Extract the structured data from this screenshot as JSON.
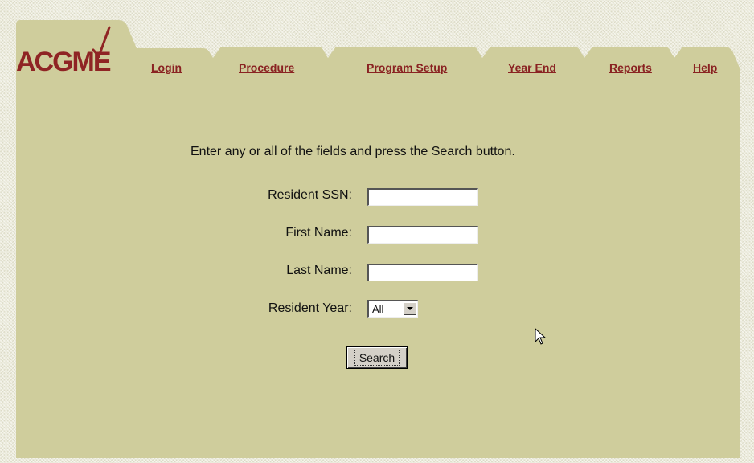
{
  "brand": {
    "logo_text": "ACGME",
    "accent": "#8a2222",
    "panel_color": "#cfcd9c"
  },
  "nav": {
    "items": [
      {
        "label": "Login"
      },
      {
        "label": "Procedure"
      },
      {
        "label": "Program Setup"
      },
      {
        "label": "Year End"
      },
      {
        "label": "Reports"
      },
      {
        "label": "Help"
      }
    ]
  },
  "form": {
    "instructions": "Enter any or all of the fields and press the Search button.",
    "fields": [
      {
        "label": "Resident SSN:",
        "value": ""
      },
      {
        "label": "First Name:",
        "value": ""
      },
      {
        "label": "Last Name:",
        "value": ""
      }
    ],
    "resident_year": {
      "label": "Resident Year:",
      "selected": "All"
    },
    "search_button": "Search"
  },
  "icons": {
    "dropdown": "chevron-down-icon",
    "cursor": "mouse-pointer-icon"
  }
}
